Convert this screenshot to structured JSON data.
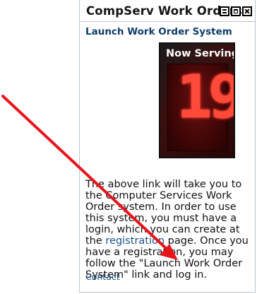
{
  "portlet": {
    "title": "CompServ Work Orders",
    "launch_link": "Launch Work Order System",
    "image": {
      "header_text": "Now Serving",
      "number": "19"
    },
    "body": {
      "text_before_link": "The above link will take you to the Computer Services Work Order system. In order to use this system, you must have a login, which you can create at the ",
      "link_text": "registration",
      "text_after_link": " page. Once you have a registration, you may follow the \"Launch Work Order System\" link and log in."
    },
    "contact_link": "Contact",
    "window_buttons": [
      "minimize-icon",
      "maximize-icon",
      "close-icon"
    ]
  },
  "colors": {
    "link": "#1a4f8a",
    "title_link": "#0f3d6b",
    "arrow": "#e8141b",
    "led": "#ff4a3a"
  }
}
